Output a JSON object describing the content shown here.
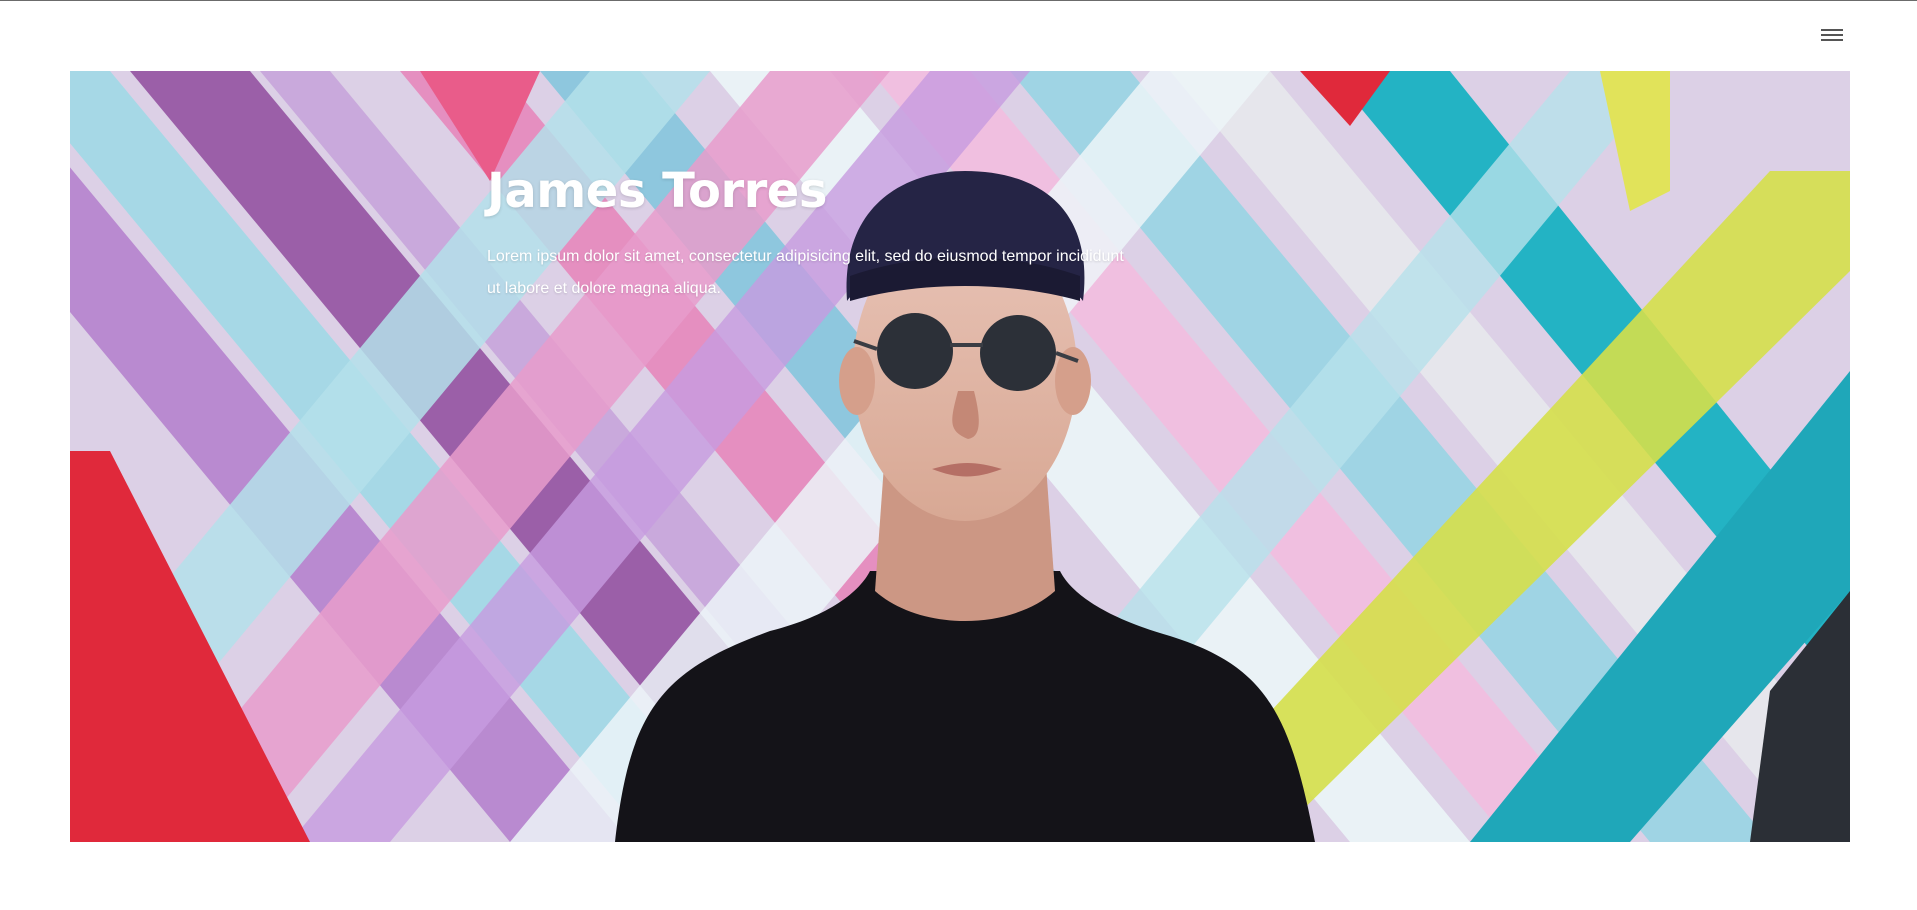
{
  "header": {
    "menu_icon": "hamburger-menu-icon"
  },
  "hero": {
    "title": "James Torres",
    "description": "Lorem ipsum dolor sit amet, consectetur adipisicing elit, sed do eiusmod tempor incididunt ut labore et dolore magna aliqua.",
    "image_subject": "young man in cap and round sunglasses in front of colorful graffiti wall",
    "colors": {
      "pink": "#e58fc0",
      "purple": "#b98ad0",
      "teal": "#23b3c4",
      "lightblue": "#9fd4e4",
      "red": "#e0293b",
      "yellow": "#d5df4a",
      "shirt": "#141318"
    }
  }
}
